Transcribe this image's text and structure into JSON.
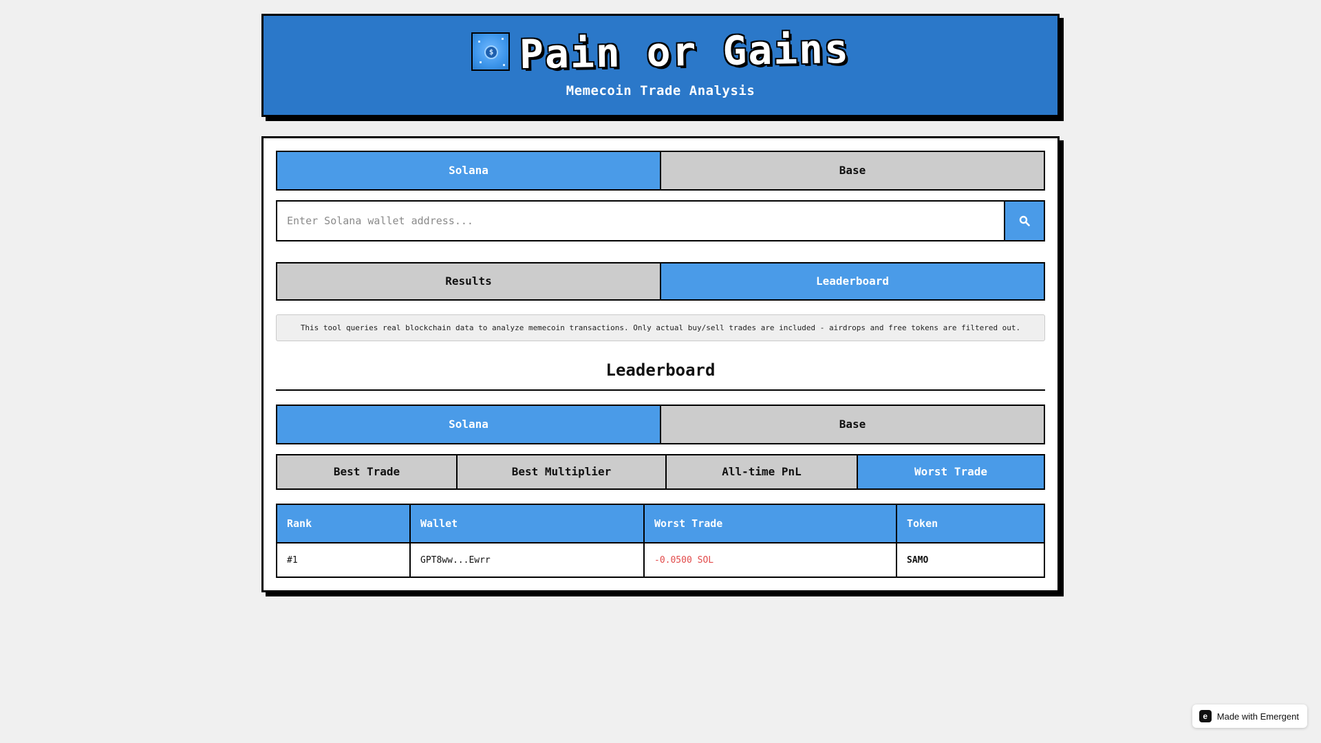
{
  "header": {
    "title": "Pain or Gains",
    "subtitle": "Memecoin Trade Analysis",
    "logo_icon": "coin-icon"
  },
  "chain_tabs": {
    "items": [
      {
        "label": "Solana",
        "active": true
      },
      {
        "label": "Base",
        "active": false
      }
    ]
  },
  "search": {
    "placeholder": "Enter Solana wallet address...",
    "value": "",
    "button_icon": "search-icon"
  },
  "view_tabs": {
    "items": [
      {
        "label": "Results",
        "active": false
      },
      {
        "label": "Leaderboard",
        "active": true
      }
    ]
  },
  "notice": "This tool queries real blockchain data to analyze memecoin transactions. Only actual buy/sell trades are included - airdrops and free tokens are filtered out.",
  "leaderboard": {
    "title": "Leaderboard",
    "chain_tabs": [
      {
        "label": "Solana",
        "active": true
      },
      {
        "label": "Base",
        "active": false
      }
    ],
    "metric_tabs": [
      {
        "label": "Best Trade",
        "active": false
      },
      {
        "label": "Best Multiplier",
        "active": false
      },
      {
        "label": "All-time PnL",
        "active": false
      },
      {
        "label": "Worst Trade",
        "active": true
      }
    ],
    "columns": [
      "Rank",
      "Wallet",
      "Worst Trade",
      "Token"
    ],
    "rows": [
      {
        "rank": "#1",
        "wallet": "GPT8ww...Ewrr",
        "value": "-0.0500 SOL",
        "token": "SAMO"
      }
    ]
  },
  "badge": {
    "label": "Made with Emergent"
  },
  "colors": {
    "header_bg": "#2b78c9",
    "active_tab": "#4a9be8",
    "inactive_tab": "#cccccc",
    "negative": "#e24a4a"
  }
}
